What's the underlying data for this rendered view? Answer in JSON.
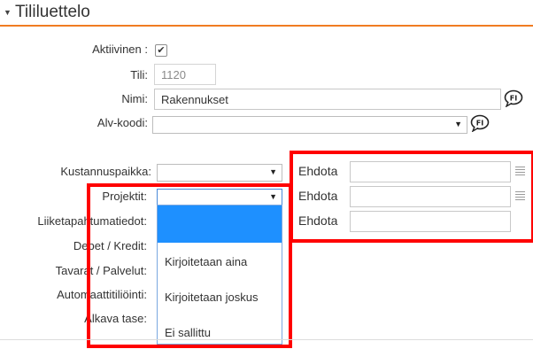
{
  "section": {
    "title": "Tililuettelo",
    "collapse_icon": "triangle-down-icon"
  },
  "form": {
    "aktiivinen": {
      "label": "Aktiivinen :",
      "checked": true
    },
    "tili": {
      "label": "Tili:",
      "value": "1120"
    },
    "nimi": {
      "label": "Nimi:",
      "value": "Rakennukset",
      "lang_badge": "FI"
    },
    "alv": {
      "label": "Alv-koodi:",
      "value": "",
      "lang_badge": "FI"
    },
    "kustannuspaikka": {
      "label": "Kustannuspaikka:",
      "value": ""
    },
    "projektit": {
      "label": "Projektit:",
      "value": ""
    },
    "liiketapahtumatiedot": {
      "label": "Liiketapahtumatiedot:"
    },
    "debet_kredit": {
      "label": "Debet / Kredit:"
    },
    "tavarat_palvelut": {
      "label": "Tavarat / Palvelut:"
    },
    "automaattitiliointi": {
      "label": "Automaattitiliöinti:"
    },
    "alkava_tase": {
      "label": "Alkava tase:"
    }
  },
  "dropdown": {
    "options": [
      "",
      "Kirjoitetaan aina",
      "Kirjoitetaan joskus",
      "Ei sallittu"
    ],
    "highlighted_index": 0
  },
  "suggestions": [
    {
      "label": "Ehdota",
      "value": "",
      "icon": "list-icon"
    },
    {
      "label": "Ehdota",
      "value": "",
      "icon": "list-icon"
    },
    {
      "label": "Ehdota",
      "value": ""
    }
  ],
  "colors": {
    "accent_rule": "#f07c22",
    "highlight_box": "#ff0000",
    "option_highlight": "#1e90ff"
  }
}
